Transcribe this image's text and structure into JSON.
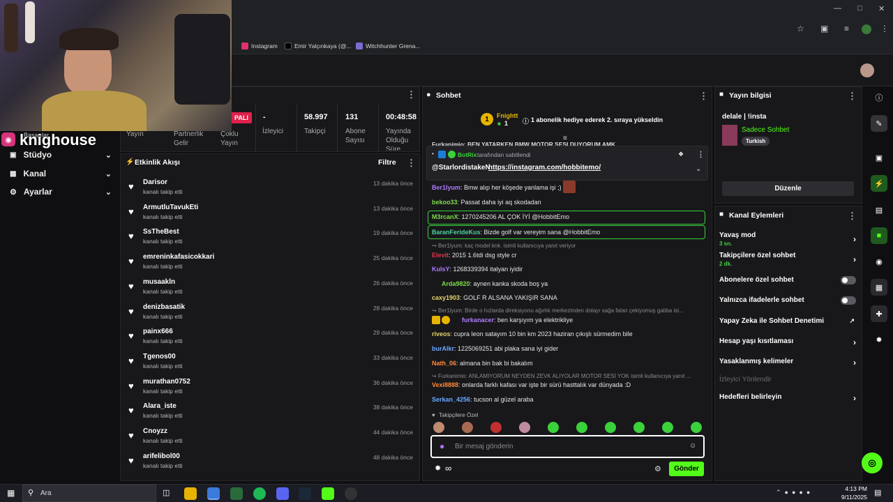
{
  "browser": {
    "bookmarks": [
      {
        "label": "Instagram",
        "icon": "instagram-icon",
        "color": "#e1306c"
      },
      {
        "label": "Emir Yalçınkaya (@...",
        "icon": "x-icon",
        "color": "#000000"
      },
      {
        "label": "Witchhunter Grena...",
        "icon": "bookmark-icon",
        "color": "#7b6ad1"
      }
    ]
  },
  "overlay": {
    "channel_name": "knighouse",
    "partial_label": "Başarılar"
  },
  "sidebar": {
    "items": [
      {
        "label": "Stüdyo",
        "icon": "studio-icon"
      },
      {
        "label": "Kanal",
        "icon": "channel-icon"
      },
      {
        "label": "Ayarlar",
        "icon": "gear-icon"
      }
    ]
  },
  "stats": {
    "badge": "PALI",
    "items": [
      {
        "label": "Yayın",
        "value": ""
      },
      {
        "label": "Partnerlik Gelir",
        "value": ""
      },
      {
        "label": "Çoklu Yayın",
        "value": ""
      },
      {
        "label": "İzleyici",
        "value": "-"
      },
      {
        "label": "Takipçi",
        "value": "58.997"
      },
      {
        "label": "Abone Sayısı",
        "value": "131"
      },
      {
        "label": "Yayında Olduğu Süre",
        "value": "00:48:58"
      }
    ]
  },
  "activity": {
    "title": "Etkinlik Akışı",
    "filter_label": "Filtre",
    "sub": "kanalı takip etti",
    "rows": [
      {
        "name": "Darisor",
        "time": "13 dakika önce"
      },
      {
        "name": "ArmutluTavukEti",
        "time": "13 dakika önce"
      },
      {
        "name": "SsTheBest",
        "time": "19 dakika önce"
      },
      {
        "name": "emreninkafasicokkari",
        "time": "25 dakika önce"
      },
      {
        "name": "musaakln",
        "time": "26 dakika önce"
      },
      {
        "name": "denizbasatik",
        "time": "28 dakika önce"
      },
      {
        "name": "painx666",
        "time": "29 dakika önce"
      },
      {
        "name": "Tgenos00",
        "time": "33 dakika önce"
      },
      {
        "name": "murathan0752",
        "time": "36 dakika önce"
      },
      {
        "name": "Alara_iste",
        "time": "38 dakika önce"
      },
      {
        "name": "Cnoyzz",
        "time": "44 dakika önce"
      },
      {
        "name": "arifelibol00",
        "time": "48 dakika önce"
      }
    ]
  },
  "chat": {
    "title": "Sohbet",
    "gift_user": "Fnightt",
    "gift_count": "1",
    "gift_text": "1 abonelik hediye ederek 2. sıraya yükseldin",
    "scroll_text": "Furkanimio: BEN YATARKEN BMW MOTOR SESI DUYORUM AMK",
    "pinned": {
      "by_user": "BotRix",
      "by_text": "tarafından sabitlendi",
      "mention": "@StarlordistakeN",
      "link": "https://instagram.com/hobbitemo/"
    },
    "messages": [
      {
        "user": "Ber1lyum",
        "color": "#b07bff",
        "text": "Bmw alıp her köşede yanlama işi ;)"
      },
      {
        "user": "bekoo33",
        "color": "#7cdc4a",
        "text": "Passat daha iyi aq skodadan"
      },
      {
        "user": "M3rcanX",
        "color": "#7cdc4a",
        "text": "1270245206 AL ÇOK İYİ @HobbitEmo"
      },
      {
        "user": "BaranFerideKus",
        "color": "#4fd1a0",
        "text": "Bizde golf var vereyim sana @HobbitEmo"
      },
      {
        "user": "Elevit",
        "color": "#e0344a",
        "text": "2015 1.6tdi dsg style cr"
      },
      {
        "user": "KulsY",
        "color": "#b07bff",
        "text": "1268339394 italyan iyidir"
      },
      {
        "user": "Arda9820",
        "color": "#7cdc4a",
        "text": "aynen kanka skoda boş ya"
      },
      {
        "user": "caxy1903",
        "color": "#e6d26a",
        "text": "GOLF R ALSANA YAKIŞIR SANA"
      },
      {
        "user": "furkanacer",
        "color": "#b07bff",
        "text": "ben karşıyım ya elektrikliye"
      },
      {
        "user": "riveos",
        "color": "#e6d26a",
        "text": "cupra leon satayım 10 bin km 2023 haziran çıkışlı sürmedim bile"
      },
      {
        "user": "burAlkr",
        "color": "#6aa8ff",
        "text": "1225069251 abi plaka sana iyi gider"
      },
      {
        "user": "Nath_06",
        "color": "#ff8a3a",
        "text": "almana bin bak bi bakalım"
      },
      {
        "user": "Vexi8888",
        "color": "#ff8a3a",
        "text": "onlarda farklı kafası var işte bir sürü hasttalık var dünyada :D"
      },
      {
        "user": "Serkan_4256",
        "color": "#6aa8ff",
        "text": "tucson al güzel araba"
      }
    ],
    "replies": [
      "Ber1lyum: kaç model knk. isimli kullanıcıya yanıt veriyor",
      "Ber1lyum: Birde o hızlarda direksiyonu ağırlık merkezinden dolayı sağa falan çekiyomuş galiba isi...",
      "Furkanimio: ANLAMIYORUM NEYDEN ZEVK ALIYOLAR MOTOR SESİ YOK isimli kullanıcıya yanıt ..."
    ],
    "emote_label": "Takipçilere Özel",
    "input_placeholder": "Bir mesaj gönderin",
    "send_label": "Gönder"
  },
  "stream_info": {
    "title": "Yayın bilgisi",
    "stream_title": "delale | !insta",
    "mode": "Sadece Sohbet",
    "language": "Turkish",
    "edit_label": "Düzenle"
  },
  "channel_actions": {
    "title": "Kanal Eylemleri",
    "items": [
      {
        "label": "Yavaş mod",
        "sub": "3 sn.",
        "control": "chevron"
      },
      {
        "label": "Takipçilere özel sohbet",
        "sub": "2 dk.",
        "control": "chevron"
      },
      {
        "label": "Abonelere özel sohbet",
        "sub": "",
        "control": "toggle"
      },
      {
        "label": "Yalnızca ifadelerle sohbet",
        "sub": "",
        "control": "toggle"
      },
      {
        "label": "Yapay Zeka ile Sohbet Denetimi",
        "sub": "",
        "control": "external"
      },
      {
        "label": "Hesap yaşı kısıtlaması",
        "sub": "",
        "control": "chevron"
      },
      {
        "label": "Yasaklanmış kelimeler",
        "sub": "",
        "control": "chevron"
      },
      {
        "label": "İzleyici Yönlendir",
        "sub": "",
        "control": "none"
      },
      {
        "label": "Hedefleri belirleyin",
        "sub": "",
        "control": "chevron"
      }
    ]
  },
  "taskbar": {
    "search_placeholder": "Ara",
    "time": "4:13 PM",
    "date": "9/11/2025"
  }
}
